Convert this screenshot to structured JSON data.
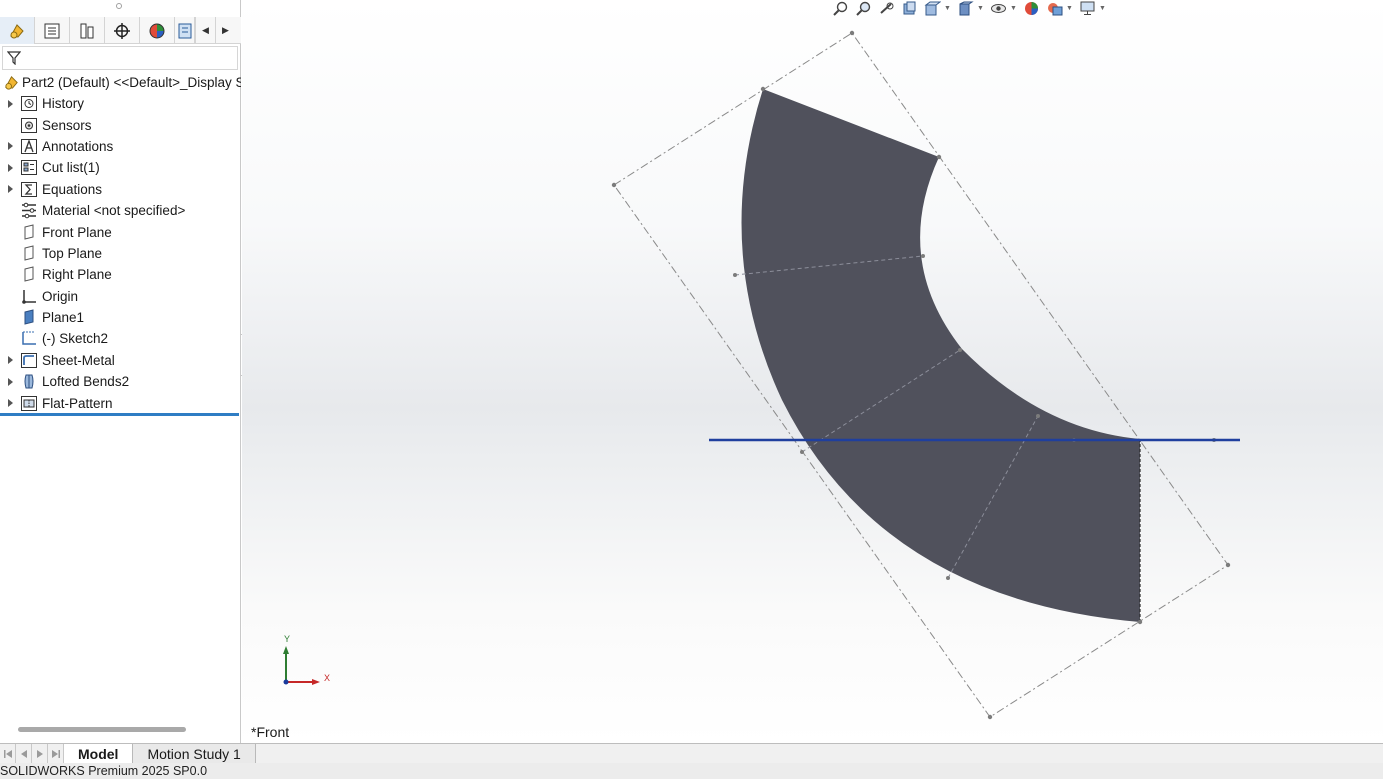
{
  "feature_tree": {
    "root_label": "Part2 (Default) <<Default>_Display S",
    "items": [
      {
        "label": "History",
        "expandable": true,
        "icon": "history-icon"
      },
      {
        "label": "Sensors",
        "expandable": false,
        "icon": "sensors-icon"
      },
      {
        "label": "Annotations",
        "expandable": true,
        "icon": "annotations-icon"
      },
      {
        "label": "Cut list(1)",
        "expandable": true,
        "icon": "cut-list-icon"
      },
      {
        "label": "Equations",
        "expandable": true,
        "icon": "equations-icon"
      },
      {
        "label": "Material <not specified>",
        "expandable": false,
        "icon": "material-icon"
      },
      {
        "label": "Front Plane",
        "expandable": false,
        "icon": "plane-icon"
      },
      {
        "label": "Top Plane",
        "expandable": false,
        "icon": "plane-icon"
      },
      {
        "label": "Right Plane",
        "expandable": false,
        "icon": "plane-icon"
      },
      {
        "label": "Origin",
        "expandable": false,
        "icon": "origin-icon"
      },
      {
        "label": "Plane1",
        "expandable": false,
        "icon": "plane-icon"
      },
      {
        "label": "(-) Sketch2",
        "expandable": false,
        "icon": "sketch-icon"
      },
      {
        "label": "Sheet-Metal",
        "expandable": true,
        "icon": "sheet-metal-icon"
      },
      {
        "label": "Lofted Bends2",
        "expandable": true,
        "icon": "lofted-bends-icon"
      },
      {
        "label": "Flat-Pattern",
        "expandable": true,
        "icon": "flat-pattern-icon"
      }
    ]
  },
  "viewport": {
    "view_name": "*Front",
    "triad": {
      "x_label": "X",
      "y_label": "Y"
    }
  },
  "bottom_tabs": {
    "model": "Model",
    "motion_study": "Motion Study 1"
  },
  "status_bar": {
    "text": "SOLIDWORKS Premium 2025 SP0.0"
  },
  "colors": {
    "part_face": "#50515c",
    "selection_line": "#1f3f9e",
    "rollback_bar": "#2f7dc4"
  }
}
